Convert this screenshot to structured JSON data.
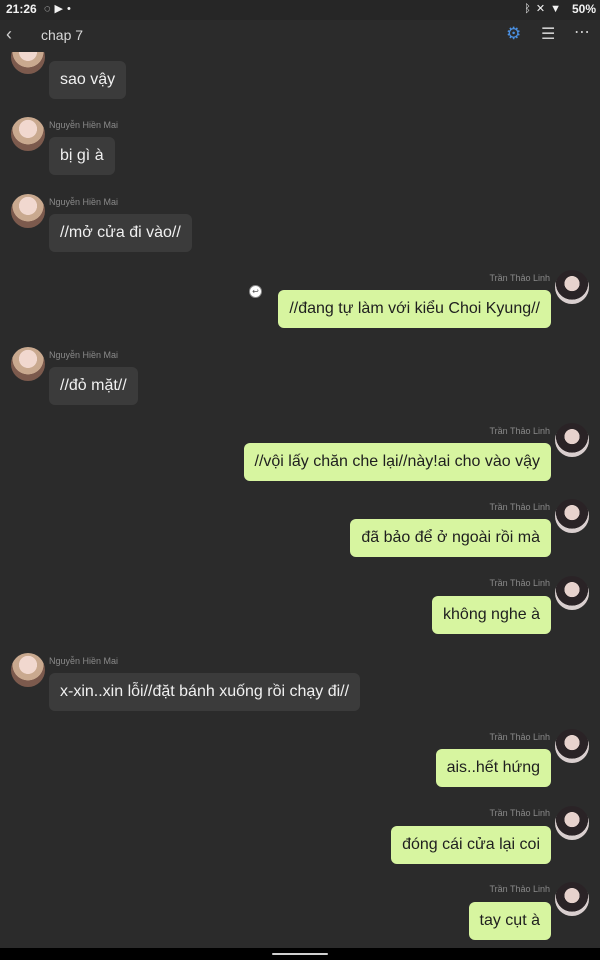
{
  "status_bar": {
    "time": "21:26",
    "left_icons": [
      "messenger-icon",
      "youtube-icon",
      "dot-icon"
    ],
    "right_icons": [
      "bluetooth-icon",
      "mute-icon",
      "wifi-icon"
    ],
    "battery": "50%"
  },
  "app_bar": {
    "title": "chap 7",
    "accent_color": "#4a90e2"
  },
  "senders": {
    "mai": "Nguyễn Hiền Mai",
    "linh": "Trần Thảo Linh"
  },
  "messages": [
    {
      "side": "left",
      "text": "sao vậy"
    },
    {
      "side": "left",
      "text": "bị gì à"
    },
    {
      "side": "left",
      "text": "//mở cửa đi vào//"
    },
    {
      "side": "right",
      "text": "//đang tự làm với kiểu Choi Kyung//"
    },
    {
      "side": "left",
      "text": "//đỏ mặt//"
    },
    {
      "side": "right",
      "text": "//vội lấy chăn che lại//này!ai cho vào vậy"
    },
    {
      "side": "right",
      "text": "đã bảo để ở ngoài rồi mà"
    },
    {
      "side": "right",
      "text": "không nghe à"
    },
    {
      "side": "left",
      "text": "x-xin..xin lỗi//đặt bánh xuống rồi chạy đi//"
    },
    {
      "side": "right",
      "text": "ais..hết hứng"
    },
    {
      "side": "right",
      "text": "đóng cái cửa lại coi"
    },
    {
      "side": "right",
      "text": "tay cụt à"
    }
  ],
  "colors": {
    "background": "#2b2b2b",
    "left_bubble": "#3b3b3b",
    "right_bubble": "#d7f5a0"
  }
}
